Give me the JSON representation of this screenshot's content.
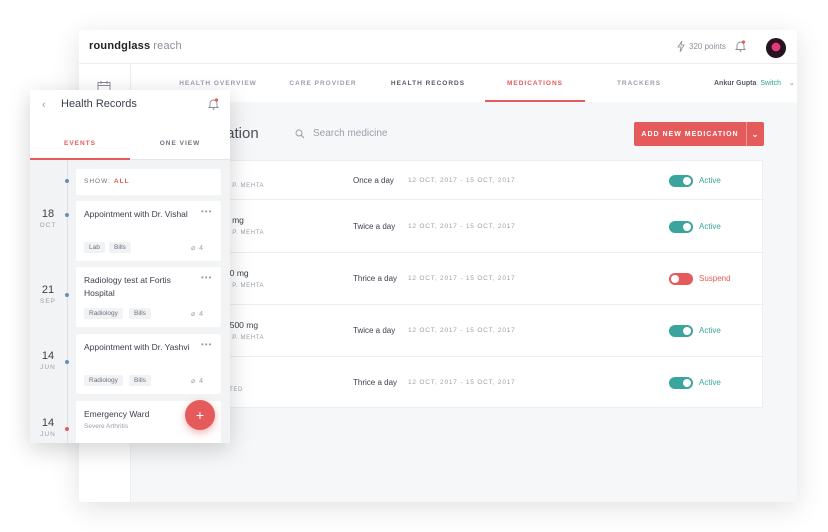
{
  "app": {
    "brand": "roundglass",
    "brand_suffix": "reach",
    "points": "320 points"
  },
  "nav": {
    "tabs": [
      {
        "label": "HEALTH OVERVIEW"
      },
      {
        "label": "CARE PROVIDER"
      },
      {
        "label": "HEALTH RECORDS"
      },
      {
        "label": "MEDICATIONS"
      },
      {
        "label": "TRACKERS"
      }
    ],
    "user_name": "Ankur Gupta",
    "switch_label": "Switch"
  },
  "medications": {
    "title": "dication",
    "search_placeholder": "Search medicine",
    "add_button": "ADD NEW MEDICATION",
    "rows": [
      {
        "name": "",
        "doctor": "H P. MEHTA",
        "frequency": "Once a day",
        "dates": "12 OCT, 2017 - 15 OCT, 2017",
        "status": "Active"
      },
      {
        "name": "5 mg",
        "doctor": "H P. MEHTA",
        "frequency": "Twice a day",
        "dates": "12 OCT, 2017 - 15 OCT, 2017",
        "status": "Active"
      },
      {
        "name": "50 mg",
        "doctor": "H P. MEHTA",
        "frequency": "Thrice a day",
        "dates": "12 OCT, 2017 - 15 OCT, 2017",
        "status": "Suspend"
      },
      {
        "name": "t 500 mg",
        "doctor": "H P. MEHTA",
        "frequency": "Twice a day",
        "dates": "12 OCT, 2017 - 15 OCT, 2017",
        "status": "Active"
      },
      {
        "name": "",
        "doctor": "ATED",
        "frequency": "Thrice a day",
        "dates": "12 OCT, 2017 - 15 OCT, 2017",
        "status": "Active"
      }
    ]
  },
  "mobile": {
    "title": "Health Records",
    "tabs": [
      {
        "label": "EVENTS"
      },
      {
        "label": "ONE VIEW"
      }
    ],
    "show_label": "SHOW:",
    "show_value": "ALL",
    "dates": [
      {
        "day": "18",
        "month": "OCT"
      },
      {
        "day": "21",
        "month": "SEP"
      },
      {
        "day": "14",
        "month": "JUN"
      },
      {
        "day": "14",
        "month": "JUN"
      }
    ],
    "events": [
      {
        "title": "Appointment with Dr. Vishal",
        "tags": [
          "Lab",
          "Bills"
        ],
        "attachments": "4"
      },
      {
        "title": "Radiology test at Fortis Hospital",
        "tags": [
          "Radiology",
          "Bills"
        ],
        "attachments": "4"
      },
      {
        "title": "Appointment with Dr. Yashvi",
        "tags": [
          "Radiology",
          "Bills"
        ],
        "attachments": "4"
      },
      {
        "title": "Emergency Ward",
        "subtitle": "Severe Arthritis"
      }
    ],
    "fab_label": "+"
  },
  "colors": {
    "accent": "#e55a5a",
    "active": "#3aa59c"
  }
}
